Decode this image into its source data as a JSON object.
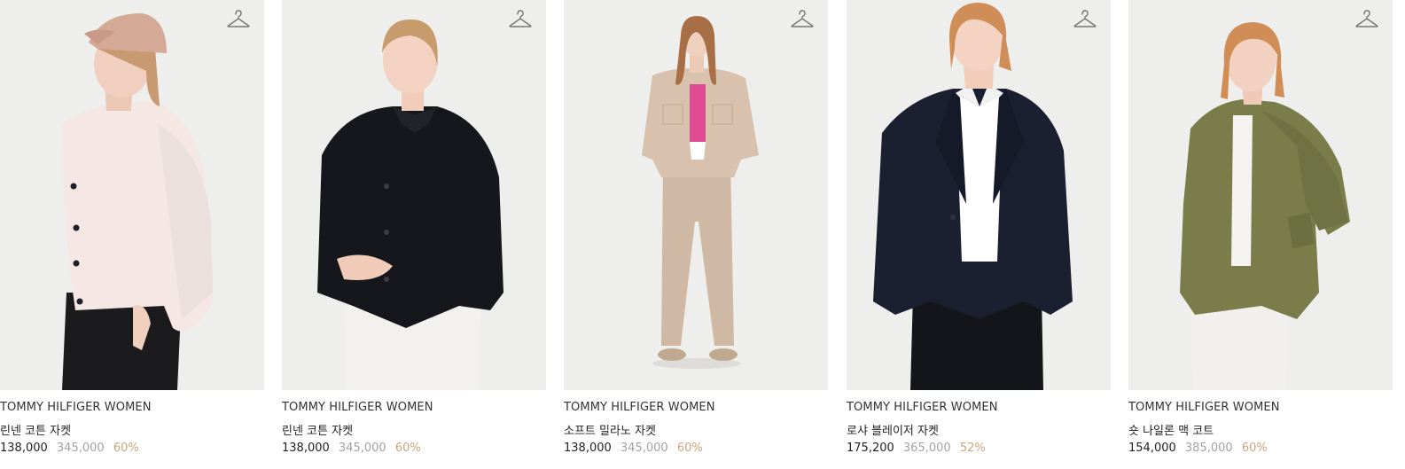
{
  "products": [
    {
      "brand": "TOMMY HILFIGER WOMEN",
      "name": "린넨 코튼 자켓",
      "price": "138,000",
      "original_price": "345,000",
      "discount": "60%",
      "image_alt": "pale pink linen cotton jacket with cap"
    },
    {
      "brand": "TOMMY HILFIGER WOMEN",
      "name": "린넨 코튼 자켓",
      "price": "138,000",
      "original_price": "345,000",
      "discount": "60%",
      "image_alt": "black linen cotton jacket"
    },
    {
      "brand": "TOMMY HILFIGER WOMEN",
      "name": "소프트 밀라노 자켓",
      "price": "138,000",
      "original_price": "345,000",
      "discount": "60%",
      "image_alt": "beige soft milano jacket and pants full body"
    },
    {
      "brand": "TOMMY HILFIGER WOMEN",
      "name": "로샤 블레이저 자켓",
      "price": "175,200",
      "original_price": "365,000",
      "discount": "52%",
      "image_alt": "navy blazer jacket with white shirt"
    },
    {
      "brand": "TOMMY HILFIGER WOMEN",
      "name": "숏 나일론 맥 코트",
      "price": "154,000",
      "original_price": "385,000",
      "discount": "60%",
      "image_alt": "olive short nylon mac coat"
    }
  ],
  "colors": {
    "photo_background": "#eeeeec",
    "discount": "#c9a47a",
    "original_price": "#a2a2a2"
  },
  "icons": {
    "wishlist": "hanger-icon"
  }
}
